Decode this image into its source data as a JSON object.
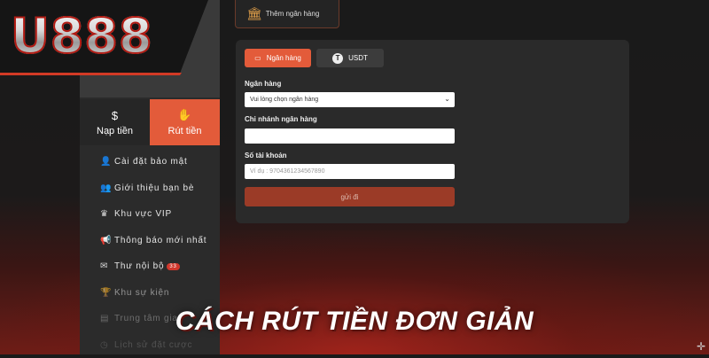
{
  "logo": {
    "text": "U888"
  },
  "sidebar": {
    "tabs": [
      {
        "label": "Nạp tiền",
        "icon": "dollar-icon"
      },
      {
        "label": "Rút tiền",
        "icon": "hand-coin-icon"
      }
    ],
    "items": [
      {
        "label": "Cài đặt bảo mật",
        "icon": "user-shield-icon"
      },
      {
        "label": "Giới thiệu bạn bè",
        "icon": "friends-icon"
      },
      {
        "label": "Khu vực VIP",
        "icon": "crown-icon"
      },
      {
        "label": "Thông báo mới nhất",
        "icon": "megaphone-icon"
      },
      {
        "label": "Thư nội bộ",
        "icon": "mail-icon",
        "badge": "33"
      },
      {
        "label": "Khu sự kiện",
        "icon": "trophy-icon"
      },
      {
        "label": "Trung tâm giao",
        "icon": "center-icon"
      },
      {
        "label": "Lịch sử đặt cược",
        "icon": "history-icon"
      }
    ]
  },
  "add_bank": {
    "label": "Thêm ngân hàng"
  },
  "form": {
    "tabs": [
      {
        "label": "Ngân hàng"
      },
      {
        "label": "USDT"
      }
    ],
    "bank_label": "Ngân hàng",
    "bank_select": "Vui lòng chọn ngân hàng",
    "branch_label": "Chi nhánh ngân hàng",
    "branch_value": "",
    "account_label": "Số tài khoản",
    "account_placeholder": "Ví dụ : 9704361234567890",
    "submit_label": "gửi đi"
  },
  "headline": "CÁCH RÚT TIỀN ĐƠN GIẢN",
  "colors": {
    "accent": "#e35b3a",
    "submit": "#9b3b27",
    "logo_stroke": "#b11a12"
  }
}
